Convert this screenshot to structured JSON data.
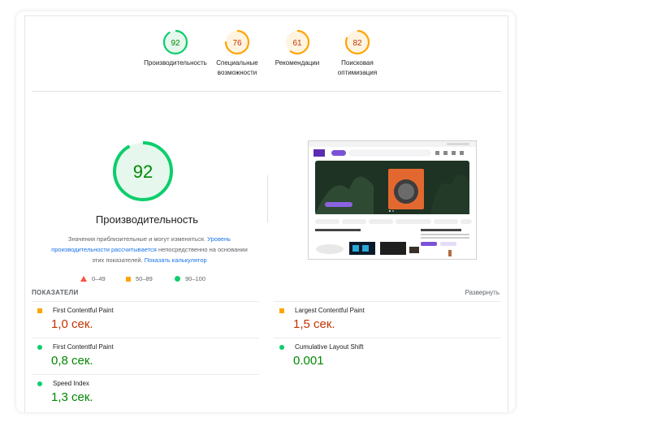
{
  "scores": [
    {
      "value": "92",
      "label": "Производительность",
      "color": "#0cce6b",
      "bg": "#e6f8ee",
      "fraction": 0.92
    },
    {
      "value": "76",
      "label": "Специальные возможности",
      "color": "#ffa400",
      "bg": "#fff4e0",
      "fraction": 0.76
    },
    {
      "value": "61",
      "label": "Рекомендации",
      "color": "#ffa400",
      "bg": "#fff4e0",
      "fraction": 0.61
    },
    {
      "value": "82",
      "label": "Поисковая оптимизация",
      "color": "#ffa400",
      "bg": "#fff4e0",
      "fraction": 0.82
    }
  ],
  "performance": {
    "score": "92",
    "fraction": 0.92,
    "title": "Производительность",
    "desc_part1": "Значения приблизительные и могут изменяться.",
    "desc_link1": "Уровень производительности рассчитывается",
    "desc_part2": "непосредственно на основании этих показателей.",
    "desc_link2": "Показать калькулятор"
  },
  "legend": {
    "fail": "0–49",
    "average": "50–89",
    "pass": "90–100"
  },
  "metrics_section": {
    "title": "ПОКАЗАТЕЛИ",
    "expand": "Развернуть"
  },
  "metrics": [
    {
      "name": "First Contentful Paint",
      "value": "1,0 сек.",
      "status": "average"
    },
    {
      "name": "Largest Contentful Paint",
      "value": "1,5 сек.",
      "status": "average"
    },
    {
      "name": "First Contentful Paint",
      "value": "0,8 сек.",
      "status": "pass"
    },
    {
      "name": "Cumulative Layout Shift",
      "value": "0.001",
      "status": "pass"
    },
    {
      "name": "Speed Index",
      "value": "1,3 сек.",
      "status": "pass"
    }
  ],
  "colors": {
    "pass": "#0cce6b",
    "average": "#ffa400",
    "fail": "#ff4e42",
    "average_text": "#c33300",
    "pass_text": "#008800",
    "link": "#1a73e8"
  }
}
